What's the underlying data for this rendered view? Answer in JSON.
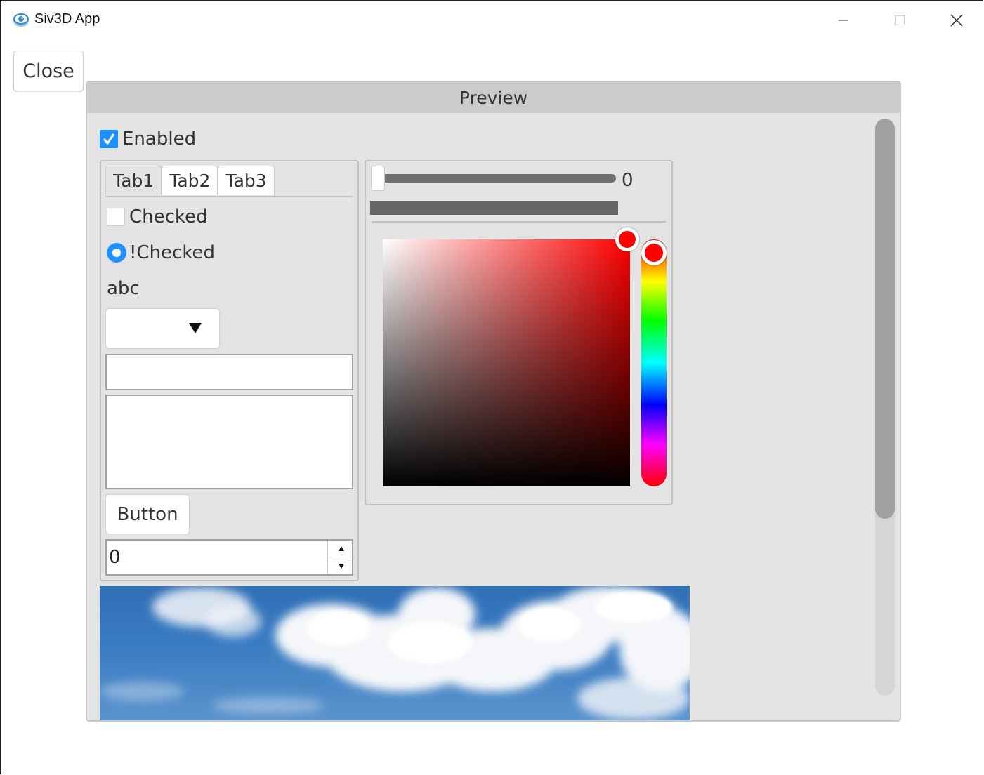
{
  "window": {
    "title": "Siv3D App",
    "icon": "siv3d-app-icon",
    "controls": [
      "minimize-icon",
      "maximize-icon",
      "close-icon"
    ]
  },
  "toolbar": {
    "close_label": "Close"
  },
  "preview": {
    "header": "Preview",
    "enabled_label": "Enabled",
    "enabled_checked": true,
    "tabs": [
      {
        "label": "Tab1",
        "selected": true
      },
      {
        "label": "Tab2",
        "selected": false
      },
      {
        "label": "Tab3",
        "selected": false
      }
    ],
    "checkbox_label": "Checked",
    "checkbox_checked": false,
    "radio_label": "!Checked",
    "radio_selected": true,
    "static_label": "abc",
    "dropdown_value": "",
    "text_input_value": "",
    "text_area_value": "",
    "button_label": "Button",
    "spinbox_value": "0",
    "slider_value": "0",
    "slider_fraction": 0.0,
    "progress_fraction": 1.0,
    "color_picker": {
      "selected_color": "#ff0000",
      "hue": 0,
      "saturation": 1.0,
      "value": 1.0
    },
    "image": "sky-clouds-image"
  },
  "colors": {
    "accent": "#1e90ff",
    "panel_bg": "#e4e4e4",
    "header_bg": "#cbcbcb"
  }
}
